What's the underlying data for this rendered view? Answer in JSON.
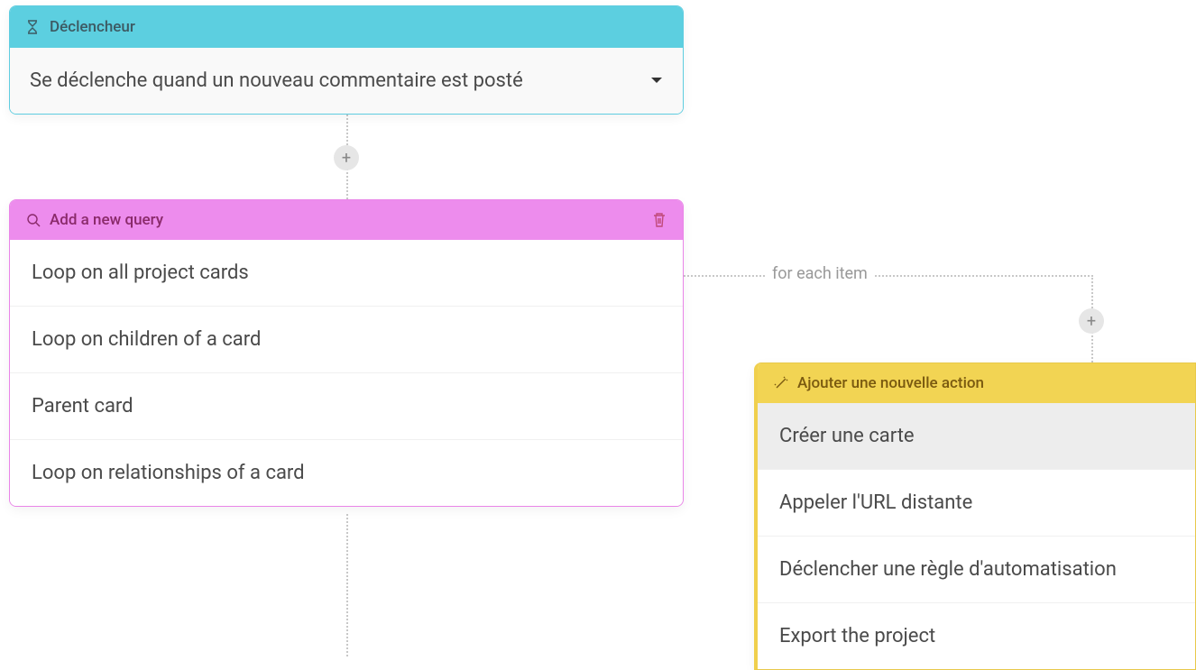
{
  "trigger": {
    "header_label": "Déclencheur",
    "selected_text": "Se déclenche quand un nouveau commentaire est posté"
  },
  "query": {
    "header_label": "Add a new query",
    "items": [
      "Loop on all project cards",
      "Loop on children of a card",
      "Parent card",
      "Loop on relationships of a card"
    ]
  },
  "action": {
    "header_label": "Ajouter une nouvelle action",
    "items": [
      "Créer une carte",
      "Appeler l'URL distante",
      "Déclencher une règle d'automatisation",
      "Export the project"
    ],
    "selected_index": 0
  },
  "connector": {
    "for_each_label": "for each item"
  }
}
